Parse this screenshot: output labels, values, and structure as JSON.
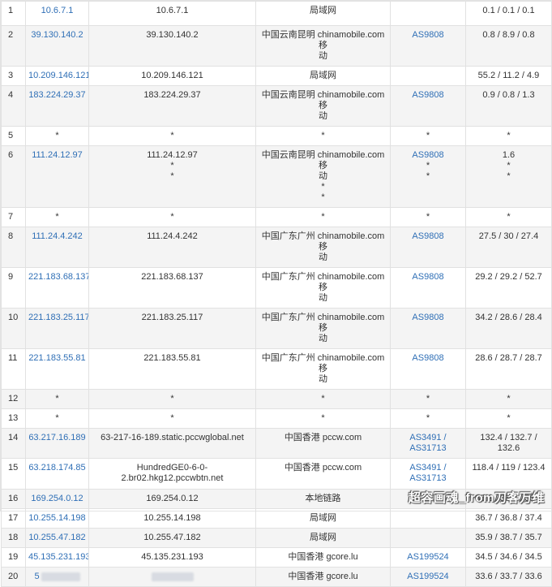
{
  "rows": [
    {
      "hop": "1",
      "ip": "10.6.7.1",
      "host": [
        "10.6.7.1"
      ],
      "loc": [
        "局域网"
      ],
      "asn": [],
      "rtt": [
        "0.1 / 0.1 / 0.1"
      ]
    },
    {
      "hop": "2",
      "ip": "39.130.140.2",
      "host": [
        "39.130.140.2"
      ],
      "loc": [
        "中国云南昆明 chinamobile.com 移",
        "动"
      ],
      "asn": [
        "AS9808"
      ],
      "rtt": [
        "0.8 / 8.9 / 0.8"
      ]
    },
    {
      "hop": "3",
      "ip": "10.209.146.121",
      "host": [
        "10.209.146.121"
      ],
      "loc": [
        "局域网"
      ],
      "asn": [],
      "rtt": [
        "55.2 / 11.2 / 4.9"
      ]
    },
    {
      "hop": "4",
      "ip": "183.224.29.37",
      "host": [
        "183.224.29.37"
      ],
      "loc": [
        "中国云南昆明 chinamobile.com 移",
        "动"
      ],
      "asn": [
        "AS9808"
      ],
      "rtt": [
        "0.9 / 0.8 / 1.3"
      ]
    },
    {
      "hop": "5",
      "ip": "*",
      "host": [
        "*"
      ],
      "loc": [
        "*"
      ],
      "asn": [
        "*"
      ],
      "rtt": [
        "*"
      ]
    },
    {
      "hop": "6",
      "ip": "111.24.12.97",
      "host": [
        "111.24.12.97",
        "*",
        "*"
      ],
      "loc": [
        "中国云南昆明 chinamobile.com 移",
        "动",
        "*",
        "*"
      ],
      "asn": [
        "AS9808",
        "*",
        "*"
      ],
      "rtt": [
        "1.6",
        "*",
        "*"
      ]
    },
    {
      "hop": "7",
      "ip": "*",
      "host": [
        "*"
      ],
      "loc": [
        "*"
      ],
      "asn": [
        "*"
      ],
      "rtt": [
        "*"
      ]
    },
    {
      "hop": "8",
      "ip": "111.24.4.242",
      "host": [
        "111.24.4.242"
      ],
      "loc": [
        "中国广东广州 chinamobile.com 移",
        "动"
      ],
      "asn": [
        "AS9808"
      ],
      "rtt": [
        "27.5 / 30 / 27.4"
      ]
    },
    {
      "hop": "9",
      "ip": "221.183.68.137",
      "host": [
        "221.183.68.137"
      ],
      "loc": [
        "中国广东广州 chinamobile.com 移",
        "动"
      ],
      "asn": [
        "AS9808"
      ],
      "rtt": [
        "29.2 / 29.2 / 52.7"
      ]
    },
    {
      "hop": "10",
      "ip": "221.183.25.117",
      "host": [
        "221.183.25.117"
      ],
      "loc": [
        "中国广东广州 chinamobile.com 移",
        "动"
      ],
      "asn": [
        "AS9808"
      ],
      "rtt": [
        "34.2 / 28.6 / 28.4"
      ]
    },
    {
      "hop": "11",
      "ip": "221.183.55.81",
      "host": [
        "221.183.55.81"
      ],
      "loc": [
        "中国广东广州 chinamobile.com 移",
        "动"
      ],
      "asn": [
        "AS9808"
      ],
      "rtt": [
        "28.6 / 28.7 / 28.7"
      ]
    },
    {
      "hop": "12",
      "ip": "*",
      "host": [
        "*"
      ],
      "loc": [
        "*"
      ],
      "asn": [
        "*"
      ],
      "rtt": [
        "*"
      ]
    },
    {
      "hop": "13",
      "ip": "*",
      "host": [
        "*"
      ],
      "loc": [
        "*"
      ],
      "asn": [
        "*"
      ],
      "rtt": [
        "*"
      ]
    },
    {
      "hop": "14",
      "ip": "63.217.16.189",
      "host": [
        "63-217-16-189.static.pccwglobal.net"
      ],
      "loc": [
        "中国香港 pccw.com"
      ],
      "asn": [
        "AS3491 /",
        "AS31713"
      ],
      "rtt": [
        "132.4 / 132.7 /",
        "132.6"
      ]
    },
    {
      "hop": "15",
      "ip": "63.218.174.85",
      "host": [
        "HundredGE0-6-0-",
        "2.br02.hkg12.pccwbtn.net"
      ],
      "loc": [
        "中国香港 pccw.com"
      ],
      "asn": [
        "AS3491 /",
        "AS31713"
      ],
      "rtt": [
        "118.4 / 119 / 123.4"
      ]
    },
    {
      "hop": "16",
      "ip": "169.254.0.12",
      "host": [
        "169.254.0.12"
      ],
      "loc": [
        "本地链路"
      ],
      "asn": [],
      "rtt": [
        "35.2 / 36.1 / 35.2"
      ]
    },
    {
      "hop": "17",
      "ip": "10.255.14.198",
      "host": [
        "10.255.14.198"
      ],
      "loc": [
        "局域网"
      ],
      "asn": [],
      "rtt": [
        "36.7 / 36.8 / 37.4"
      ]
    },
    {
      "hop": "18",
      "ip": "10.255.47.182",
      "host": [
        "10.255.47.182"
      ],
      "loc": [
        "局域网"
      ],
      "asn": [],
      "rtt": [
        "35.9 / 38.7 / 35.7"
      ]
    },
    {
      "hop": "19",
      "ip": "45.135.231.193",
      "host": [
        "45.135.231.193"
      ],
      "loc": [
        "中国香港 gcore.lu"
      ],
      "asn": [
        "AS199524"
      ],
      "rtt": [
        "34.5 / 34.6 / 34.5"
      ]
    },
    {
      "hop": "20",
      "ip": "5",
      "host": [
        ""
      ],
      "loc": [
        "中国香港 gcore.lu"
      ],
      "asn": [
        "AS199524"
      ],
      "rtt": [
        "33.6 / 33.7 / 33.6"
      ],
      "redacted": true
    }
  ],
  "watermark": "超容画魂_from刀客万维"
}
